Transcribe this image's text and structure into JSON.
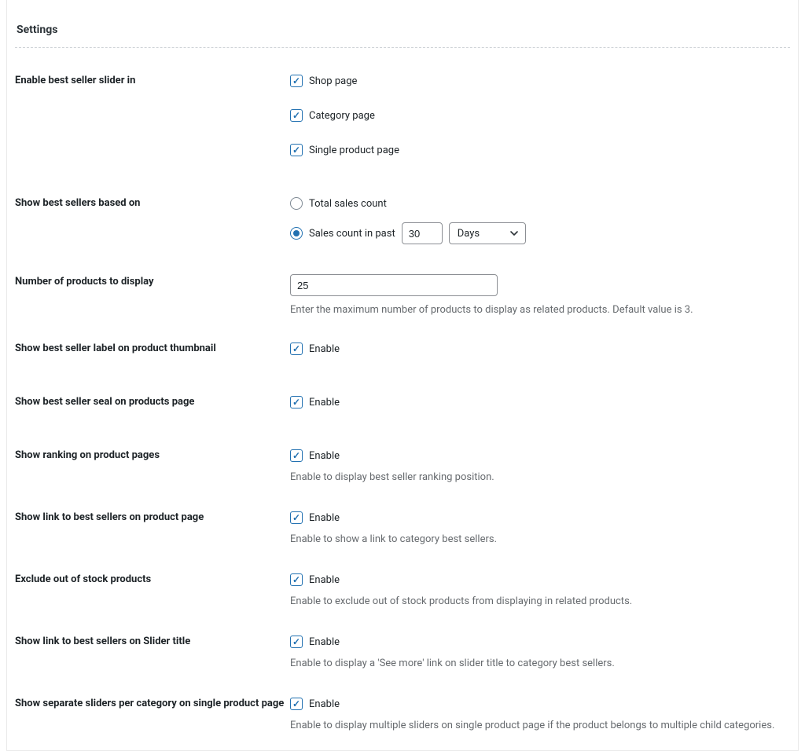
{
  "title": "Settings",
  "enable_slider": {
    "label": "Enable best seller slider in",
    "options": [
      {
        "label": "Shop page",
        "checked": true
      },
      {
        "label": "Category page",
        "checked": true
      },
      {
        "label": "Single product page",
        "checked": true
      }
    ]
  },
  "based_on": {
    "label": "Show best sellers based on",
    "total_label": "Total sales count",
    "past_label": "Sales count in past",
    "selected": "past",
    "past_value": "30",
    "unit_label": "Days"
  },
  "num_products": {
    "label": "Number of products to display",
    "value": "25",
    "help": "Enter the maximum number of products to display as related products. Default value is 3."
  },
  "rows": [
    {
      "key": "label_thumb",
      "label": "Show best seller label on product thumbnail",
      "enable_label": "Enable",
      "checked": true,
      "help": ""
    },
    {
      "key": "seal_page",
      "label": "Show best seller seal on products page",
      "enable_label": "Enable",
      "checked": true,
      "help": ""
    },
    {
      "key": "ranking",
      "label": "Show ranking on product pages",
      "enable_label": "Enable",
      "checked": true,
      "help": "Enable to display best seller ranking position."
    },
    {
      "key": "link_product",
      "label": "Show link to best sellers on product page",
      "enable_label": "Enable",
      "checked": true,
      "help": "Enable to show a link to category best sellers."
    },
    {
      "key": "exclude_oos",
      "label": "Exclude out of stock products",
      "enable_label": "Enable",
      "checked": true,
      "help": "Enable to exclude out of stock products from displaying in related products."
    },
    {
      "key": "link_slider_title",
      "label": "Show link to best sellers on Slider title",
      "enable_label": "Enable",
      "checked": true,
      "help": "Enable to display a 'See more' link on slider title to category best sellers."
    },
    {
      "key": "sep_sliders",
      "label": "Show separate sliders per category on single product page",
      "enable_label": "Enable",
      "checked": true,
      "help": "Enable to display multiple sliders on single product page if the product belongs to multiple child categories."
    }
  ]
}
